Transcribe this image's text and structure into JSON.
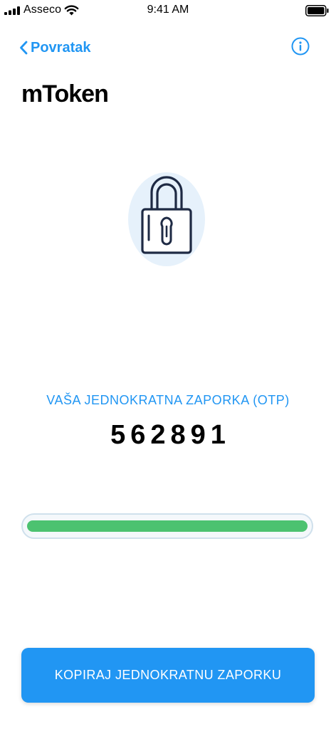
{
  "status_bar": {
    "carrier": "Asseco",
    "time": "9:41 AM",
    "icons": [
      "signal-icon",
      "wifi-icon",
      "battery-icon"
    ]
  },
  "nav": {
    "back_label": "Povratak",
    "back_icon": "chevron-left-icon",
    "info_icon": "info-icon"
  },
  "app_title": "mToken",
  "illustration_icon": "lock-icon",
  "otp": {
    "label": "VAŠA JEDNOKRATNA ZAPORKA (OTP)",
    "code": "562891"
  },
  "progress": {
    "fraction": 0.98
  },
  "copy_button": {
    "label": "KOPIRAJ JEDNOKRATNU ZAPORKU"
  },
  "colors": {
    "accent": "#2196F3",
    "progress": "#4CC270",
    "lock_stroke": "#1E2A44",
    "lock_background": "#E6F1FB"
  }
}
